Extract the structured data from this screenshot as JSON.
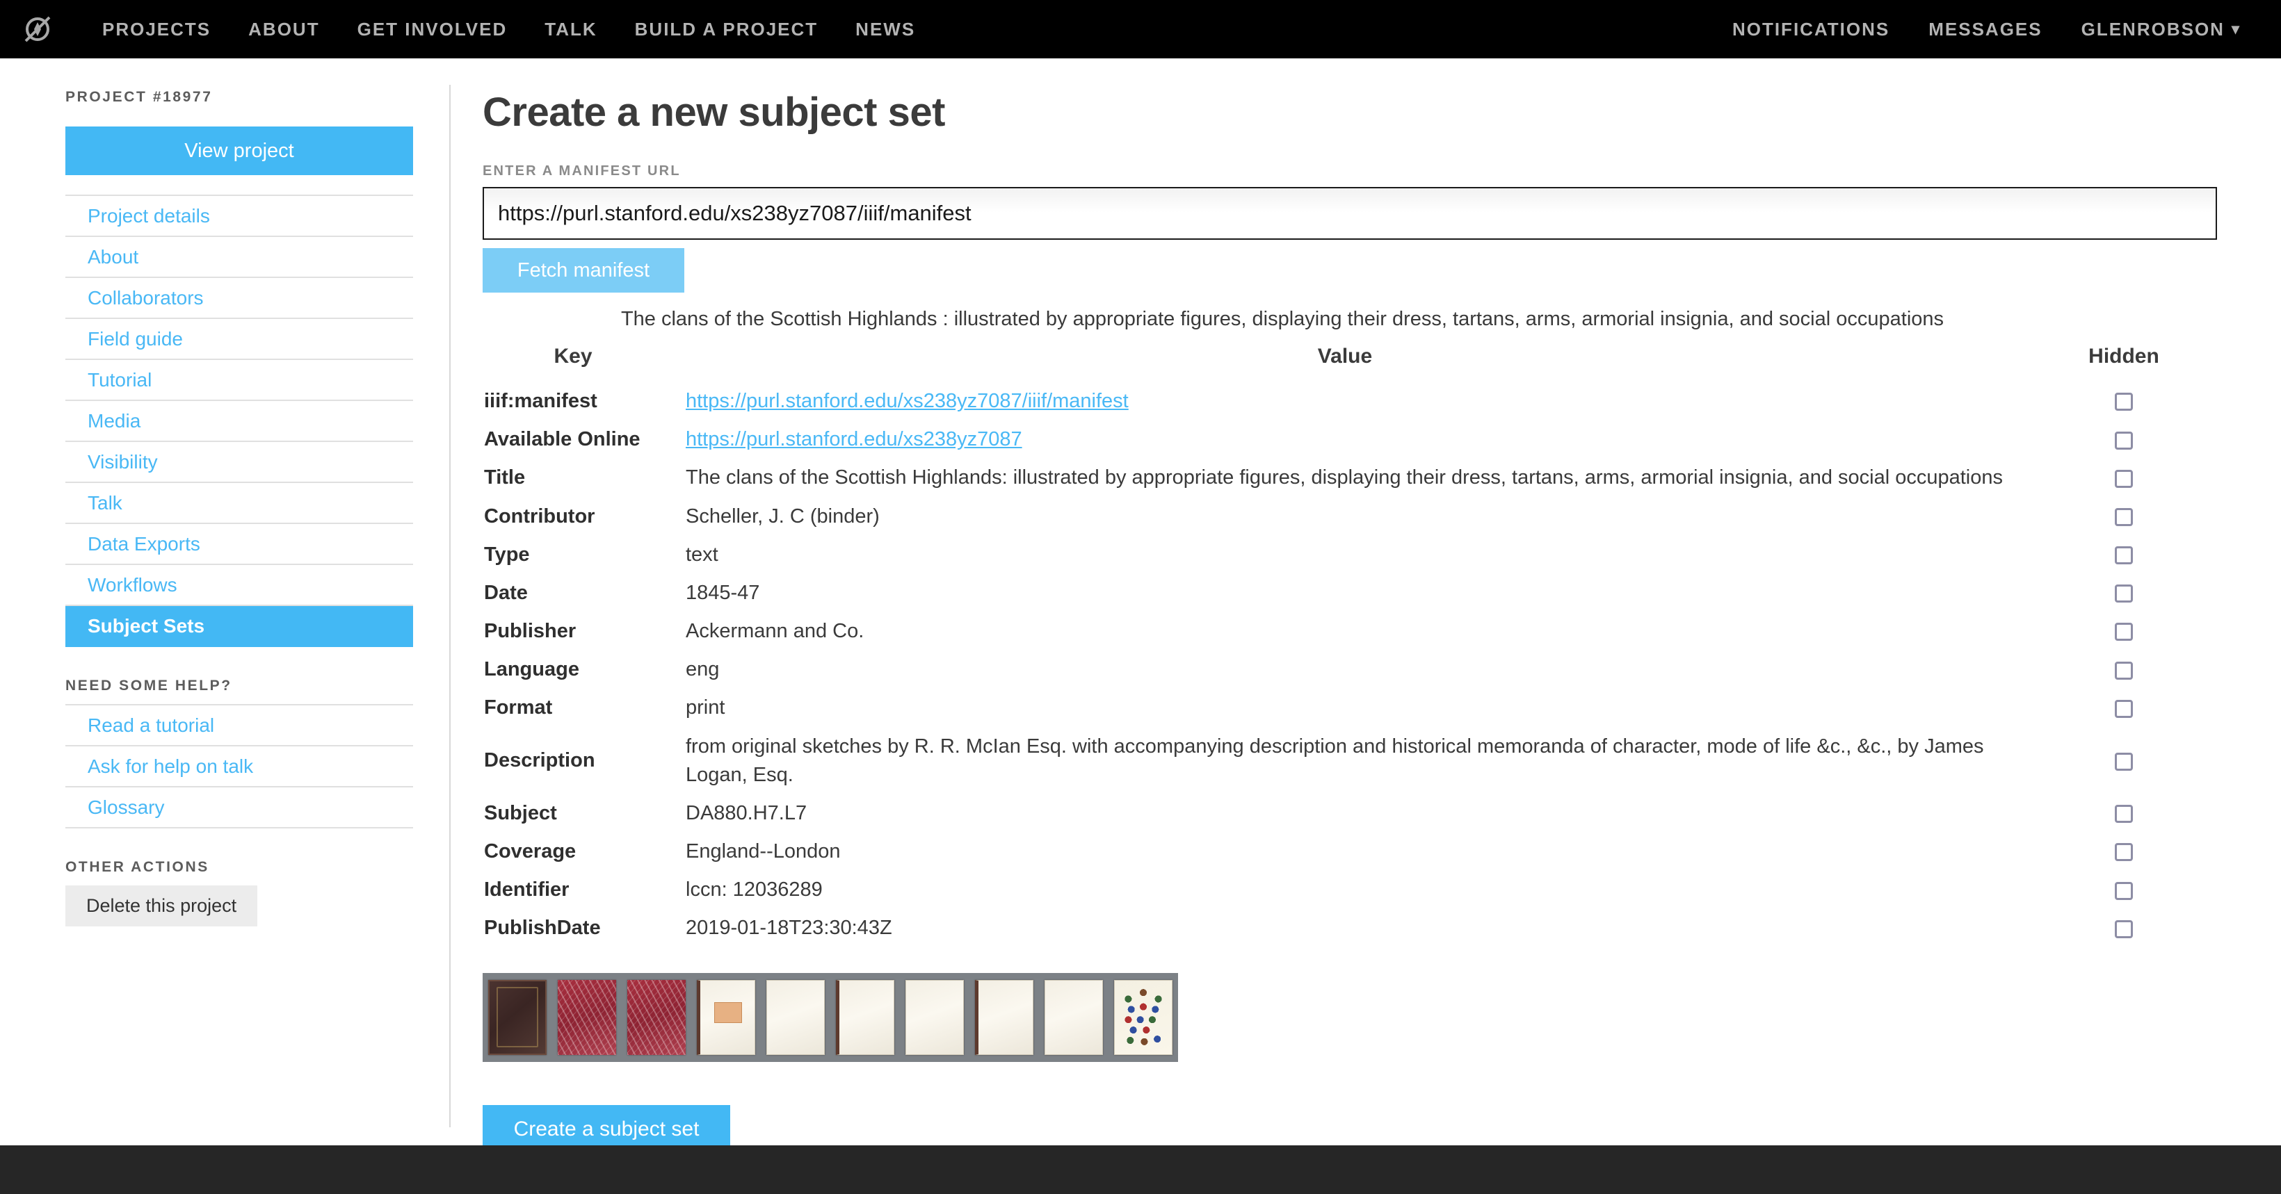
{
  "header": {
    "logo": "zooniverse-logo",
    "nav_left": [
      "PROJECTS",
      "ABOUT",
      "GET INVOLVED",
      "TALK",
      "BUILD A PROJECT",
      "NEWS"
    ],
    "nav_right": [
      "NOTIFICATIONS",
      "MESSAGES"
    ],
    "user": "GLENROBSON",
    "user_caret": "⌄"
  },
  "sidebar": {
    "eyebrow": "PROJECT #18977",
    "view_project_label": "View project",
    "items": [
      {
        "label": "Project details",
        "active": false
      },
      {
        "label": "About",
        "active": false
      },
      {
        "label": "Collaborators",
        "active": false
      },
      {
        "label": "Field guide",
        "active": false
      },
      {
        "label": "Tutorial",
        "active": false
      },
      {
        "label": "Media",
        "active": false
      },
      {
        "label": "Visibility",
        "active": false
      },
      {
        "label": "Talk",
        "active": false
      },
      {
        "label": "Data Exports",
        "active": false
      },
      {
        "label": "Workflows",
        "active": false
      },
      {
        "label": "Subject Sets",
        "active": true
      }
    ],
    "help_eyebrow": "NEED SOME HELP?",
    "help_items": [
      {
        "label": "Read a tutorial"
      },
      {
        "label": "Ask for help on talk"
      },
      {
        "label": "Glossary"
      }
    ],
    "other_eyebrow": "OTHER ACTIONS",
    "delete_label": "Delete this project"
  },
  "main": {
    "title": "Create a new subject set",
    "manifest_field_label": "ENTER A MANIFEST URL",
    "manifest_url_value": "https://purl.stanford.edu/xs238yz7087/iiif/manifest",
    "manifest_url_placeholder": "https://",
    "fetch_label": "Fetch manifest",
    "manifest_caption": "The clans of the Scottish Highlands : illustrated by appropriate figures, displaying their dress, tartans, arms, armorial insignia, and social occupations",
    "create_label": "Create a subject set"
  },
  "table": {
    "columns": [
      "Key",
      "Value",
      "Hidden"
    ],
    "rows": [
      {
        "key": "iiif:manifest",
        "value": "https://purl.stanford.edu/xs238yz7087/iiif/manifest",
        "is_link": true,
        "hidden": false
      },
      {
        "key": "Available Online",
        "value": "https://purl.stanford.edu/xs238yz7087",
        "is_link": true,
        "hidden": false
      },
      {
        "key": "Title",
        "value": "The clans of the Scottish Highlands: illustrated by appropriate figures, displaying their dress, tartans, arms, armorial insignia, and social occupations",
        "is_link": false,
        "hidden": false
      },
      {
        "key": "Contributor",
        "value": "Scheller, J. C (binder)",
        "is_link": false,
        "hidden": false
      },
      {
        "key": "Type",
        "value": "text",
        "is_link": false,
        "hidden": false
      },
      {
        "key": "Date",
        "value": "1845-47",
        "is_link": false,
        "hidden": false
      },
      {
        "key": "Publisher",
        "value": "Ackermann and Co.",
        "is_link": false,
        "hidden": false
      },
      {
        "key": "Language",
        "value": "eng",
        "is_link": false,
        "hidden": false
      },
      {
        "key": "Format",
        "value": "print",
        "is_link": false,
        "hidden": false
      },
      {
        "key": "Description",
        "value": "from original sketches by R. R. McIan Esq. with accompanying description and historical memoranda of character, mode of life &c., &c., by James Logan, Esq.",
        "is_link": false,
        "hidden": false
      },
      {
        "key": "Subject",
        "value": "DA880.H7.L7",
        "is_link": false,
        "hidden": false
      },
      {
        "key": "Coverage",
        "value": "England--London",
        "is_link": false,
        "hidden": false
      },
      {
        "key": "Identifier",
        "value": "lccn: 12036289",
        "is_link": false,
        "hidden": false
      },
      {
        "key": "PublishDate",
        "value": "2019-01-18T23:30:43Z",
        "is_link": false,
        "hidden": false
      }
    ]
  },
  "thumbnails": [
    {
      "name": "front-cover",
      "style": "t-darkcover"
    },
    {
      "name": "marbled-endpaper-left",
      "style": "t-marbled"
    },
    {
      "name": "marbled-endpaper-right",
      "style": "t-marbled"
    },
    {
      "name": "bookplate-page",
      "style": "t-cream t-label bound"
    },
    {
      "name": "blank-page-1",
      "style": "t-cream"
    },
    {
      "name": "blank-page-2",
      "style": "t-cream bound"
    },
    {
      "name": "blank-page-3",
      "style": "t-cream"
    },
    {
      "name": "blank-page-4",
      "style": "t-cream bound"
    },
    {
      "name": "blank-page-5",
      "style": "t-cream"
    },
    {
      "name": "armorial-plate",
      "style": "t-arms"
    }
  ],
  "colors": {
    "brand_blue": "#43b8f4",
    "link_blue": "#49b8f5",
    "fetch_blue": "#7ccdf6",
    "topbar_black": "#000000",
    "footer_dark": "#262626",
    "checkbox_border": "#8d8da5"
  }
}
